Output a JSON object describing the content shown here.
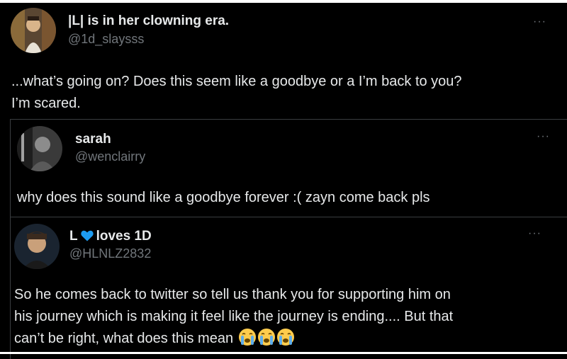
{
  "tweets": [
    {
      "display_name": "|L| is in her clowning era.",
      "handle": "@1d_slaysss",
      "text_line1": "...what’s going on? Does this seem like a goodbye or a I’m back to you?",
      "text_line2": "I’m scared."
    },
    {
      "display_name": "sarah",
      "handle": "@wenclairry",
      "text": "why does this sound like a goodbye forever :( zayn come back pls"
    },
    {
      "display_name_prefix": "L",
      "display_name_suffix": "loves 1D",
      "handle": "@HLNLZ2832",
      "text_line1": "So he comes back to twitter so tell us thank you for supporting him on",
      "text_line2": "his journey which is making it feel like the journey is ending.... But that",
      "text_line3": "can’t be right, what does this mean"
    }
  ],
  "more_glyph": "···",
  "colors": {
    "background": "#000000",
    "text": "#e7e9ea",
    "secondary": "#71767b",
    "heart": "#1d9bf0",
    "border": "#3a3d40"
  },
  "icons": [
    "more-options-icon",
    "blue-heart-icon",
    "crying-face-icon"
  ]
}
